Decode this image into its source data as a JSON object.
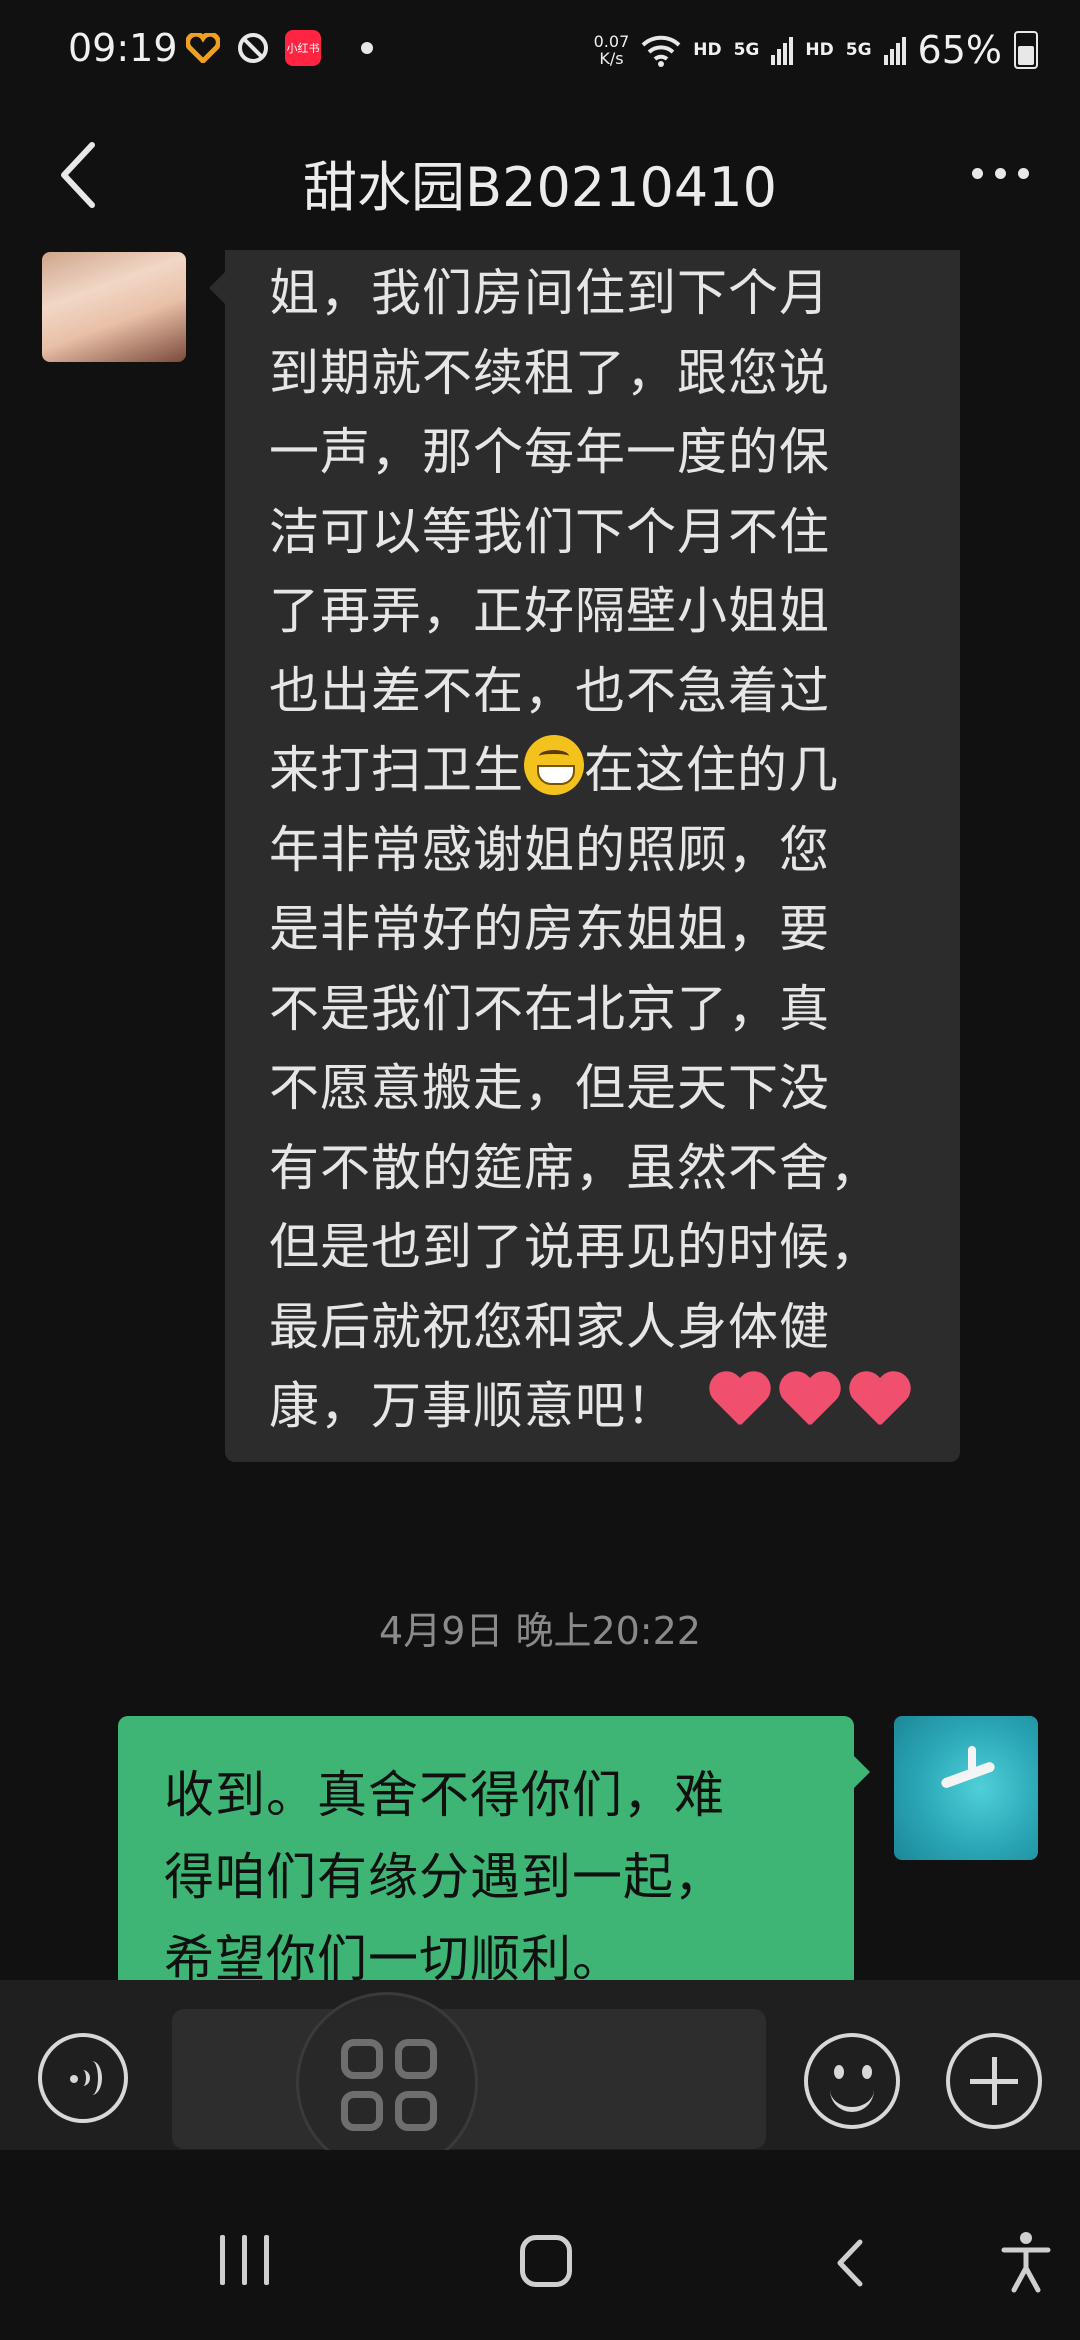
{
  "status_bar": {
    "time": "09:19",
    "app_icon_label": "小红书",
    "network_speed_value": "0.07",
    "network_speed_unit": "K/s",
    "hd1": "HD",
    "net1": "5G",
    "hd2": "HD",
    "net2": "5G",
    "battery": "65%"
  },
  "header": {
    "title": "甜水园B20210410"
  },
  "messages": [
    {
      "side": "left",
      "text_part1": "姐，我们房间住到下个月\n到期就不续租了，跟您说\n一声，那个每年一度的保\n洁可以等我们下个月不住\n了再弄，正好隔壁小姐姐\n也出差不在，也不急着过\n来打扫卫生",
      "text_part2": "在这住的几\n年非常感谢姐的照顾，您\n是非常好的房东姐姐，要\n不是我们不在北京了，真\n不愿意搬走，但是天下没\n有不散的筵席，虽然不舍，\n但是也到了说再见的时候，\n最后就祝您和家人身体健\n康，万事顺意吧！",
      "emoji_inline": "grinning-face",
      "emoji_trailing": [
        "heart",
        "heart",
        "heart"
      ]
    },
    {
      "side": "right",
      "text": "收到。真舍不得你们，难\n得咱们有缘分遇到一起，\n希望你们一切顺利。"
    }
  ],
  "timestamp": "4月9日 晚上20:22",
  "icons": {
    "back": "chevron-left-icon",
    "more": "more-dots-icon",
    "voice": "voice-icon",
    "grid": "grid-icon",
    "emoji": "emoji-icon",
    "plus": "plus-icon"
  },
  "colors": {
    "background": "#111111",
    "bubble_left": "#2c2c2c",
    "bubble_right": "#3eb575",
    "input_bar": "#1f1f1f"
  }
}
